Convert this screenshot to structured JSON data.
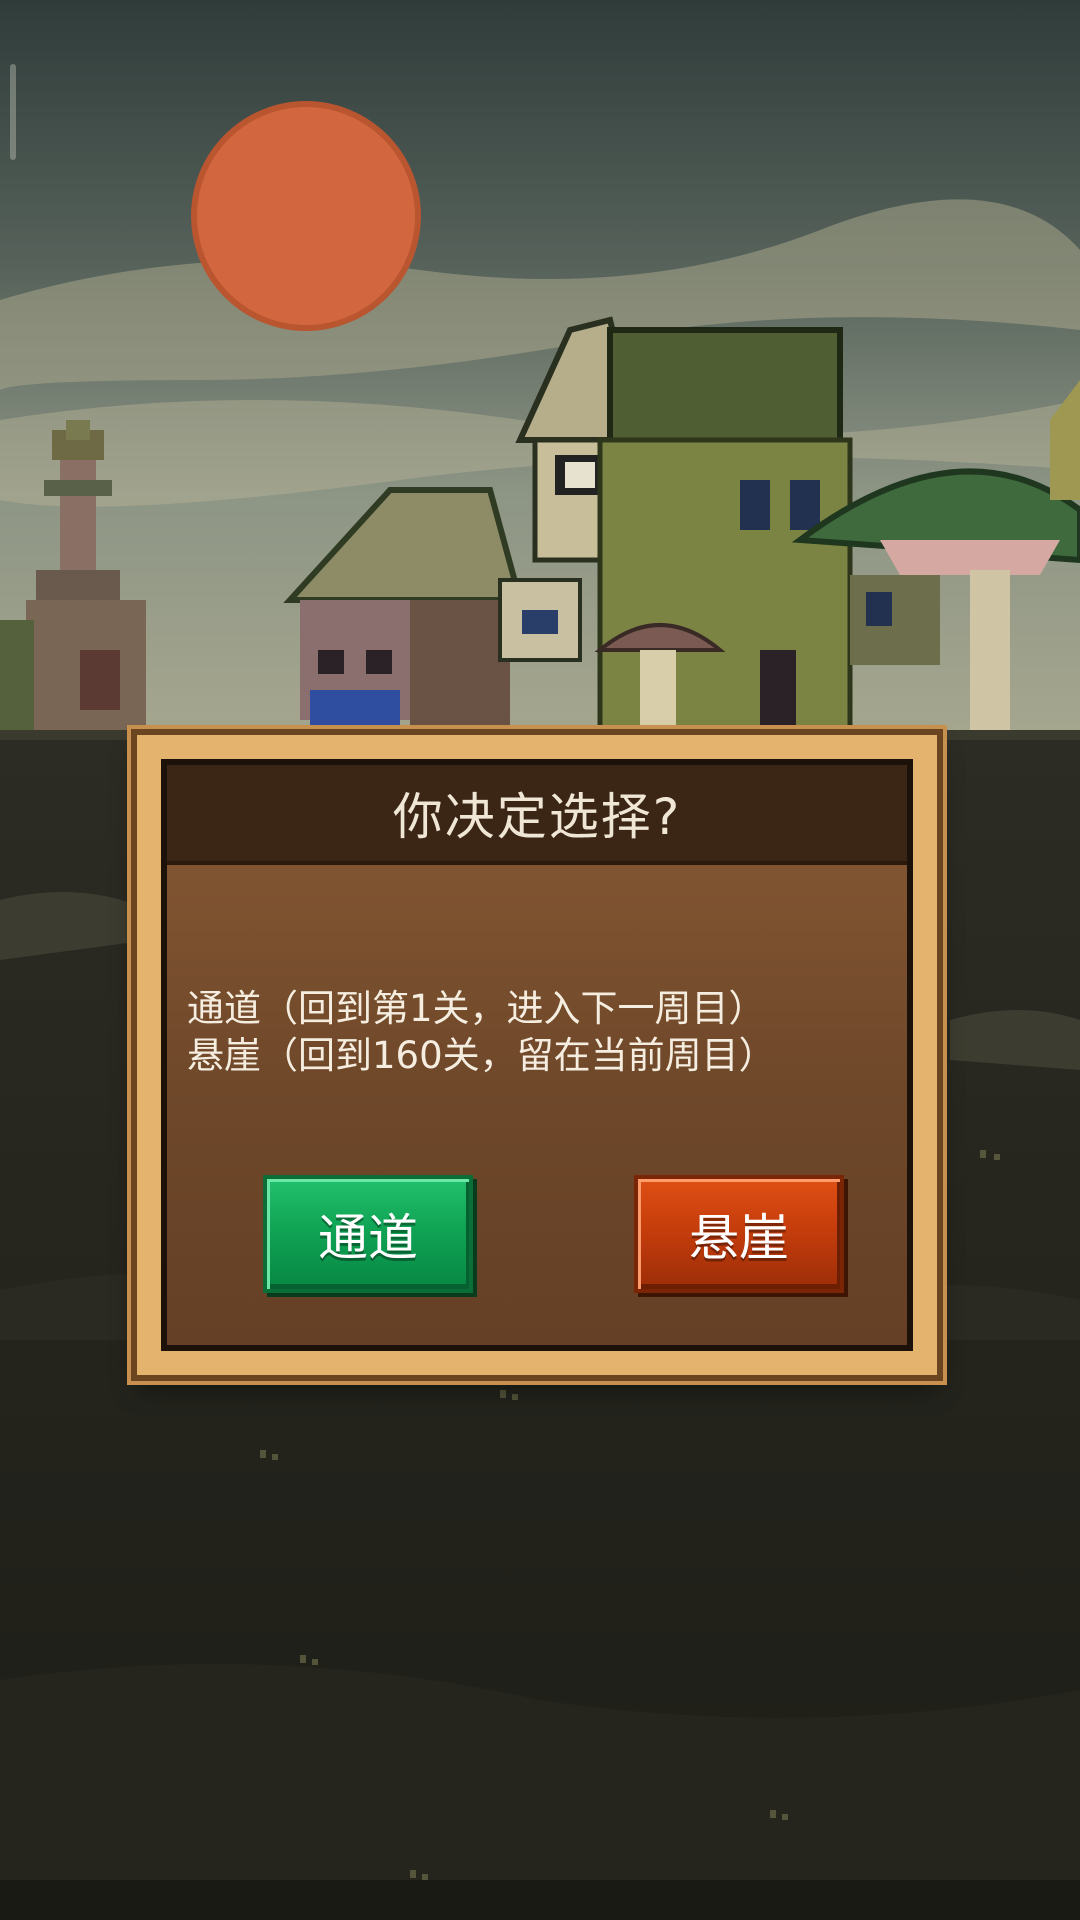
{
  "dialog": {
    "title": "你决定选择?",
    "options": [
      "通道（回到第1关，进入下一周目）",
      "悬崖（回到160关，留在当前周目）"
    ],
    "passage_button": "通道",
    "cliff_button": "悬崖"
  },
  "colors": {
    "passage_button": "#10a455",
    "cliff_button": "#c63d0c",
    "dialog_frame": "#e4b36e",
    "dialog_header": "#3b2514",
    "dialog_body": "#7a4f2e",
    "sun": "#d2663f"
  }
}
